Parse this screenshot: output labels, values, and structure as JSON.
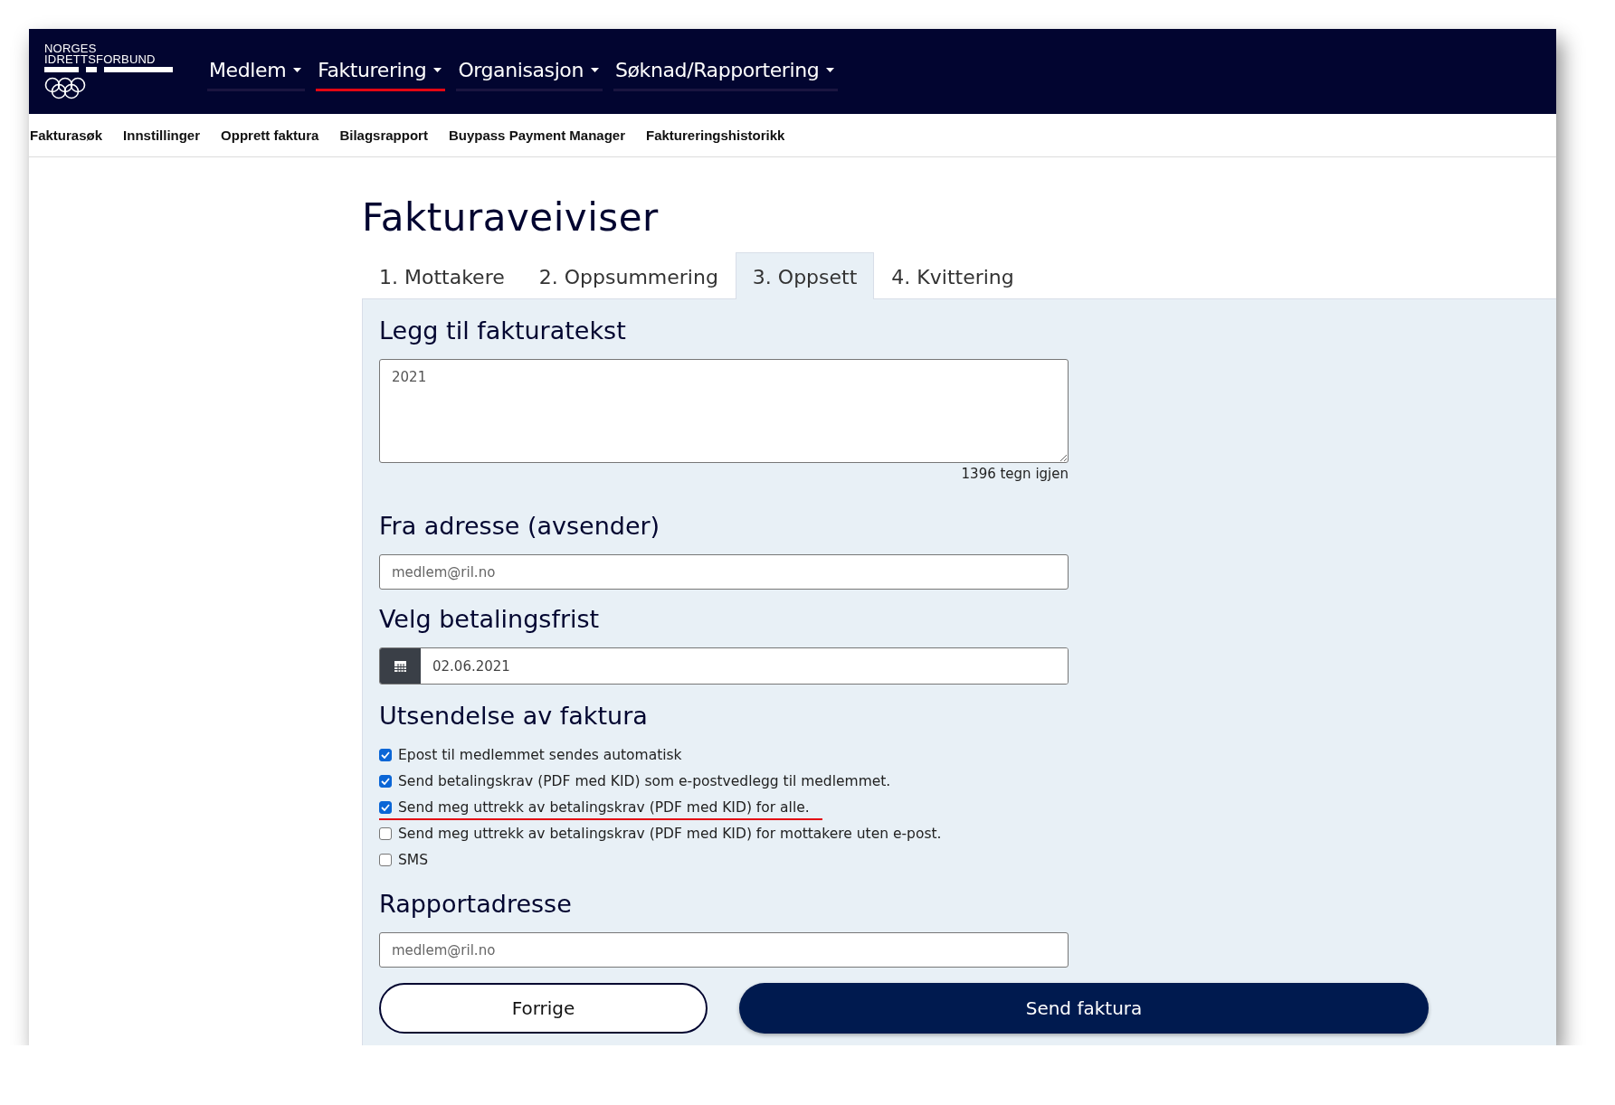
{
  "brand": {
    "line1": "NORGES",
    "line2": "IDRETTSFORBUND"
  },
  "nav": [
    {
      "label": "Medlem",
      "selected": false
    },
    {
      "label": "Fakturering",
      "selected": true
    },
    {
      "label": "Organisasjon",
      "selected": false
    },
    {
      "label": "Søknad/Rapportering",
      "selected": false
    }
  ],
  "subnav": [
    "Fakturasøk",
    "Innstillinger",
    "Opprett faktura",
    "Bilagsrapport",
    "Buypass Payment Manager",
    "Faktureringshistorikk"
  ],
  "page_title": "Fakturaveiviser",
  "steps": [
    {
      "label": "1. Mottakere",
      "selected": false
    },
    {
      "label": "2. Oppsummering",
      "selected": false
    },
    {
      "label": "3. Oppsett",
      "selected": true
    },
    {
      "label": "4. Kvittering",
      "selected": false
    }
  ],
  "invoice_text": {
    "heading": "Legg til fakturatekst",
    "value": "2021",
    "counter": "1396 tegn igjen"
  },
  "from_address": {
    "heading": "Fra adresse (avsender)",
    "placeholder": "medlem@ril.no"
  },
  "due_date": {
    "heading": "Velg betalingsfrist",
    "value": "02.06.2021"
  },
  "delivery": {
    "heading": "Utsendelse av faktura",
    "options": [
      {
        "label": "Epost til medlemmet sendes automatisk",
        "checked": true,
        "underlined": false
      },
      {
        "label": "Send betalingskrav (PDF med KID) som e-postvedlegg til medlemmet.",
        "checked": true,
        "underlined": false
      },
      {
        "label": "Send meg uttrekk av betalingskrav (PDF med KID) for alle.",
        "checked": true,
        "underlined": true
      },
      {
        "label": "Send meg uttrekk av betalingskrav (PDF med KID) for mottakere uten e-post.",
        "checked": false,
        "underlined": false
      },
      {
        "label": "SMS",
        "checked": false,
        "underlined": false
      }
    ]
  },
  "report_address": {
    "heading": "Rapportadresse",
    "placeholder": "medlem@ril.no"
  },
  "buttons": {
    "back": "Forrige",
    "submit": "Send faktura"
  }
}
